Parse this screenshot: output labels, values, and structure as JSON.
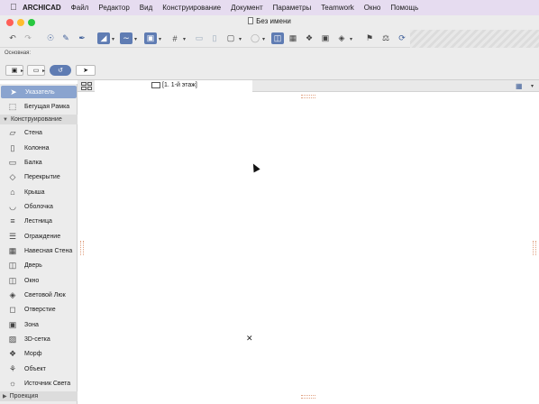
{
  "menubar": {
    "apple_icon": "apple-icon",
    "app_name": "ARCHICAD",
    "items": [
      "Файл",
      "Редактор",
      "Вид",
      "Конструирование",
      "Документ",
      "Параметры",
      "Teamwork",
      "Окно",
      "Помощь"
    ]
  },
  "window": {
    "title": "Без имени",
    "traffic_lights": {
      "close": "#ff5f57",
      "minimize": "#febc2e",
      "zoom": "#28c840"
    }
  },
  "infobox": {
    "label": "Основная:"
  },
  "toolbox": {
    "pointer_tool": "Указатель",
    "marquee_tool": "Бегущая Рамка",
    "design_group": "Конструирование",
    "design_tools": [
      "Стена",
      "Колонна",
      "Балка",
      "Перекрытие",
      "Крыша",
      "Оболочка",
      "Лестница",
      "Ограждение",
      "Навесная Стена",
      "Дверь",
      "Окно",
      "Световой Люк",
      "Отверстие",
      "Зона",
      "3D-сетка",
      "Морф",
      "Объект",
      "Источник Света"
    ],
    "projection_group": "Проекция"
  },
  "tabs": {
    "active_label": "[1. 1-й этаж]"
  },
  "colors": {
    "menubar_bg": "#e6dcf0",
    "selection": "#8aa4cf",
    "toolbar_accent": "#5f7cb3"
  }
}
